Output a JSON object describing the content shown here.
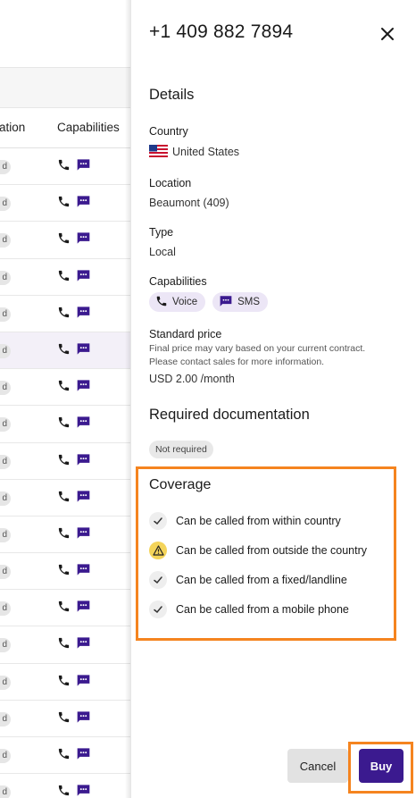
{
  "table": {
    "col_location_partial": "ation",
    "col_capabilities": "Capabilities",
    "row_badge_partial": "d",
    "row_count": 18,
    "highlighted_row_index": 5
  },
  "drawer": {
    "title": "+1 409 882 7894",
    "details": {
      "heading": "Details",
      "country_label": "Country",
      "country_value": "United States",
      "location_label": "Location",
      "location_value": "Beaumont (409)",
      "type_label": "Type",
      "type_value": "Local",
      "capabilities_label": "Capabilities",
      "capabilities": [
        {
          "label": "Voice",
          "icon": "phone-icon"
        },
        {
          "label": "SMS",
          "icon": "sms-icon"
        }
      ],
      "price_label": "Standard price",
      "price_hint_line1": "Final price may vary based on your current contract.",
      "price_hint_line2": "Please contact sales for more information.",
      "price_value": "USD 2.00 /month"
    },
    "documentation": {
      "heading": "Required documentation",
      "badge": "Not required"
    },
    "coverage": {
      "heading": "Coverage",
      "items": [
        {
          "label": "Can be called from within country",
          "status": "check"
        },
        {
          "label": "Can be called from outside the country",
          "status": "warning"
        },
        {
          "label": "Can be called from a fixed/landline",
          "status": "check"
        },
        {
          "label": "Can be called from a mobile phone",
          "status": "check"
        }
      ]
    },
    "actions": {
      "cancel": "Cancel",
      "buy": "Buy"
    }
  },
  "colors": {
    "accent": "#3b1a8f",
    "highlight": "#f5841f",
    "chip_bg": "#ece6f6",
    "warning": "#f4d45a"
  }
}
